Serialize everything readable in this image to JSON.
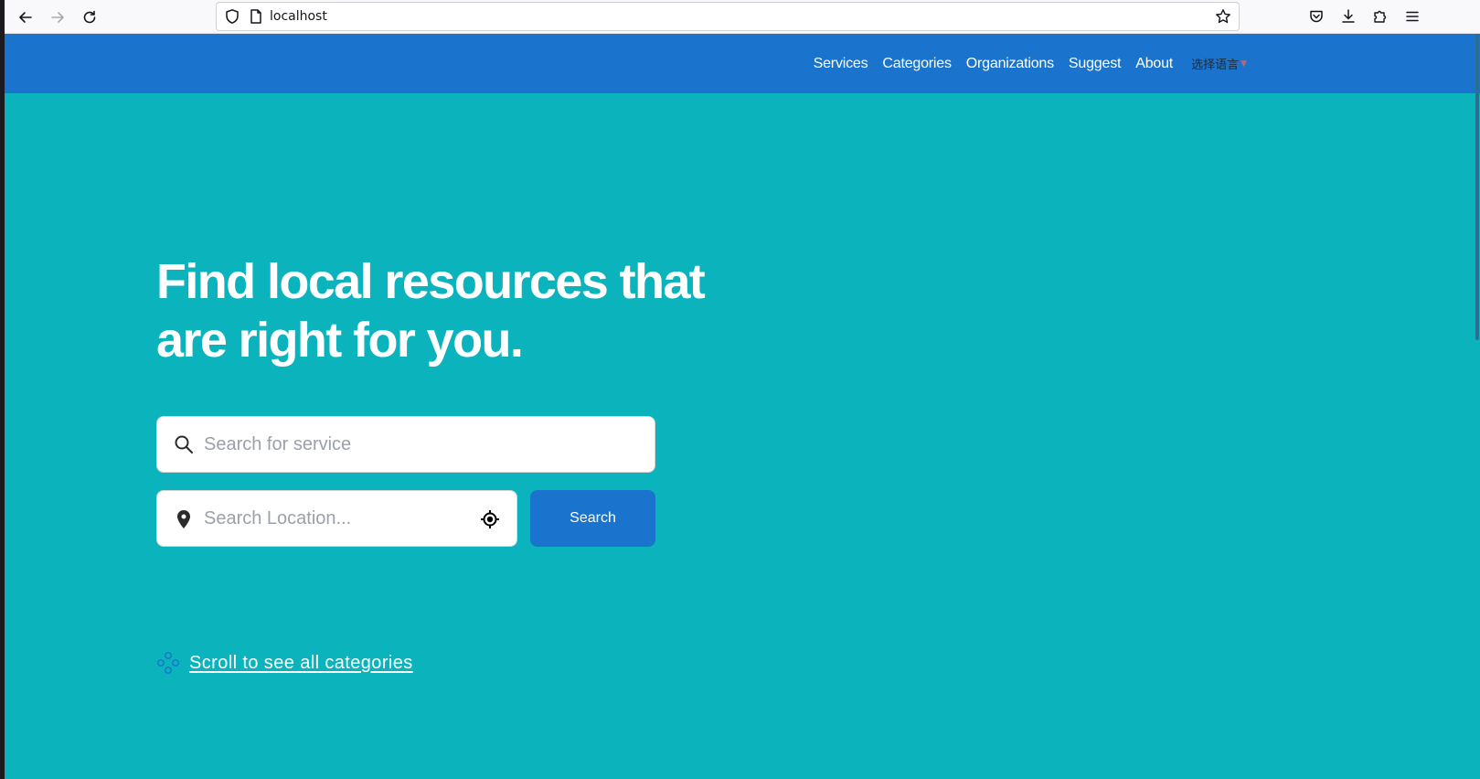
{
  "browser": {
    "url": "localhost",
    "icons": {
      "back": "arrow-left-icon",
      "forward": "arrow-right-icon",
      "reload": "reload-icon",
      "shield": "shield-icon",
      "page": "page-icon",
      "bookmark": "star-icon",
      "pocket": "pocket-icon",
      "downloads": "download-icon",
      "extensions": "puzzle-icon",
      "menu": "hamburger-menu-icon"
    }
  },
  "header": {
    "background": "#1a73cc",
    "nav": [
      {
        "label": "Services"
      },
      {
        "label": "Categories"
      },
      {
        "label": "Organizations"
      },
      {
        "label": "Suggest"
      },
      {
        "label": "About"
      }
    ],
    "language_select": "选择语言"
  },
  "hero": {
    "background": "#0bb3bc",
    "title": "Find local resources that are right for you.",
    "service_placeholder": "Search for service",
    "location_placeholder": "Search Location...",
    "search_button": "Search",
    "scroll_link": "Scroll to see all categories"
  }
}
